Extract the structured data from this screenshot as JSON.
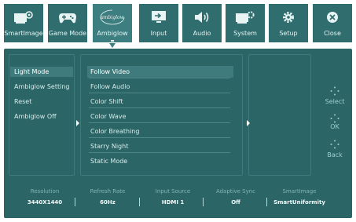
{
  "tabs": [
    {
      "label": "SmartImage",
      "icon": "smartimage-icon",
      "active": false
    },
    {
      "label": "Game Mode",
      "icon": "gamepad-icon",
      "active": false
    },
    {
      "label": "Ambiglow",
      "icon": "ambiglow-logo-icon",
      "logo_text": "ambiglow",
      "active": true
    },
    {
      "label": "Input",
      "icon": "input-icon",
      "active": false
    },
    {
      "label": "Audio",
      "icon": "speaker-icon",
      "active": false
    },
    {
      "label": "System",
      "icon": "system-icon",
      "active": false
    },
    {
      "label": "Setup",
      "icon": "gear-icon",
      "active": false
    },
    {
      "label": "Close",
      "icon": "close-icon",
      "active": false
    }
  ],
  "menu_level1": {
    "items": [
      "Light Mode",
      "Ambiglow Setting",
      "Reset",
      "Ambiglow Off"
    ],
    "selected_index": 0
  },
  "menu_level2": {
    "items": [
      "Follow Video",
      "Follow Audio",
      "Color Shift",
      "Color Wave",
      "Color Breathing",
      "Starry Night",
      "Static Mode"
    ],
    "selected_index": 0
  },
  "hints": {
    "select": "Select",
    "ok": "OK",
    "back": "Back"
  },
  "status": {
    "headers": [
      "Resolution",
      "Refresh Rate",
      "Input Source",
      "Adaptive Sync",
      "SmartImage"
    ],
    "values": [
      "3440X1440",
      "60Hz",
      "HDMI 1",
      "Off",
      "SmartUniformity"
    ]
  },
  "colors": {
    "tab_bg": "#2f6d6e",
    "panel_bg": "#2b6566",
    "highlight": "#3f7b7c",
    "text": "#d7ecec"
  }
}
